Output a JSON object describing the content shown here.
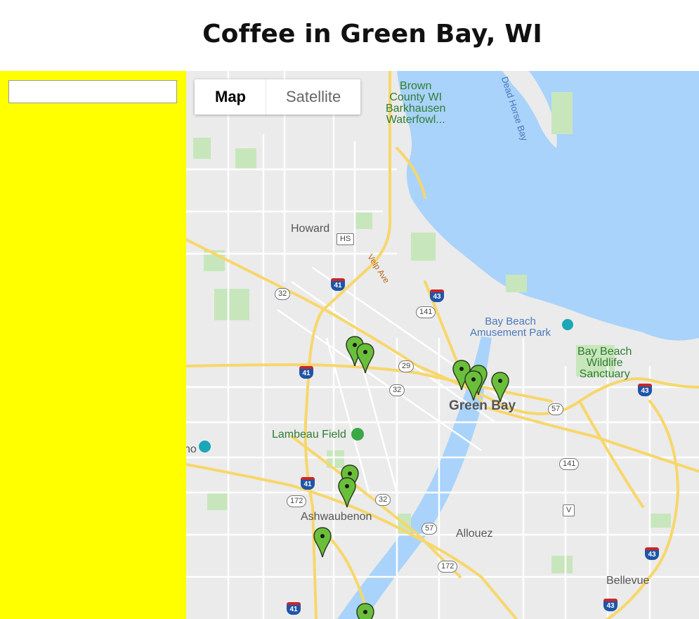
{
  "page": {
    "title": "Coffee in Green Bay, WI"
  },
  "sidebar": {
    "search": {
      "value": "",
      "placeholder": ""
    },
    "background": "#ffff00"
  },
  "map": {
    "type_control": {
      "map_label": "Map",
      "satellite_label": "Satellite",
      "selected": "Map"
    },
    "labels": {
      "brown_county": "Brown\nCounty WI\nBarkhausen\nWaterfowl...",
      "dead_horse_bay": "Dead Horse Bay",
      "howard": "Howard",
      "velp_ave": "Velp Ave",
      "bay_beach_amusement": "Bay Beach\nAmusement Park",
      "bay_beach_wildlife": "Bay Beach\nWildlife\nSanctuary",
      "green_bay": "Green Bay",
      "lambeau_field": "Lambeau Field",
      "ashwaubenon": "Ashwaubenon",
      "allouez": "Allouez",
      "bellevue": "Bellevue",
      "no_fragment": "no"
    },
    "shields": {
      "hs": "HS",
      "r32a": "32",
      "i41a": "41",
      "i43a": "43",
      "r141a": "141",
      "r29": "29",
      "r32b": "32",
      "i41b": "41",
      "i43b": "43",
      "r57a": "57",
      "r141b": "141",
      "i41c": "41",
      "r172a": "172",
      "r32c": "32",
      "v": "V",
      "r57b": "57",
      "r172b": "172",
      "i43c": "43",
      "i43d": "43",
      "i41d": "41"
    },
    "marker_color": "#6abf3a",
    "marker_count": 11
  }
}
